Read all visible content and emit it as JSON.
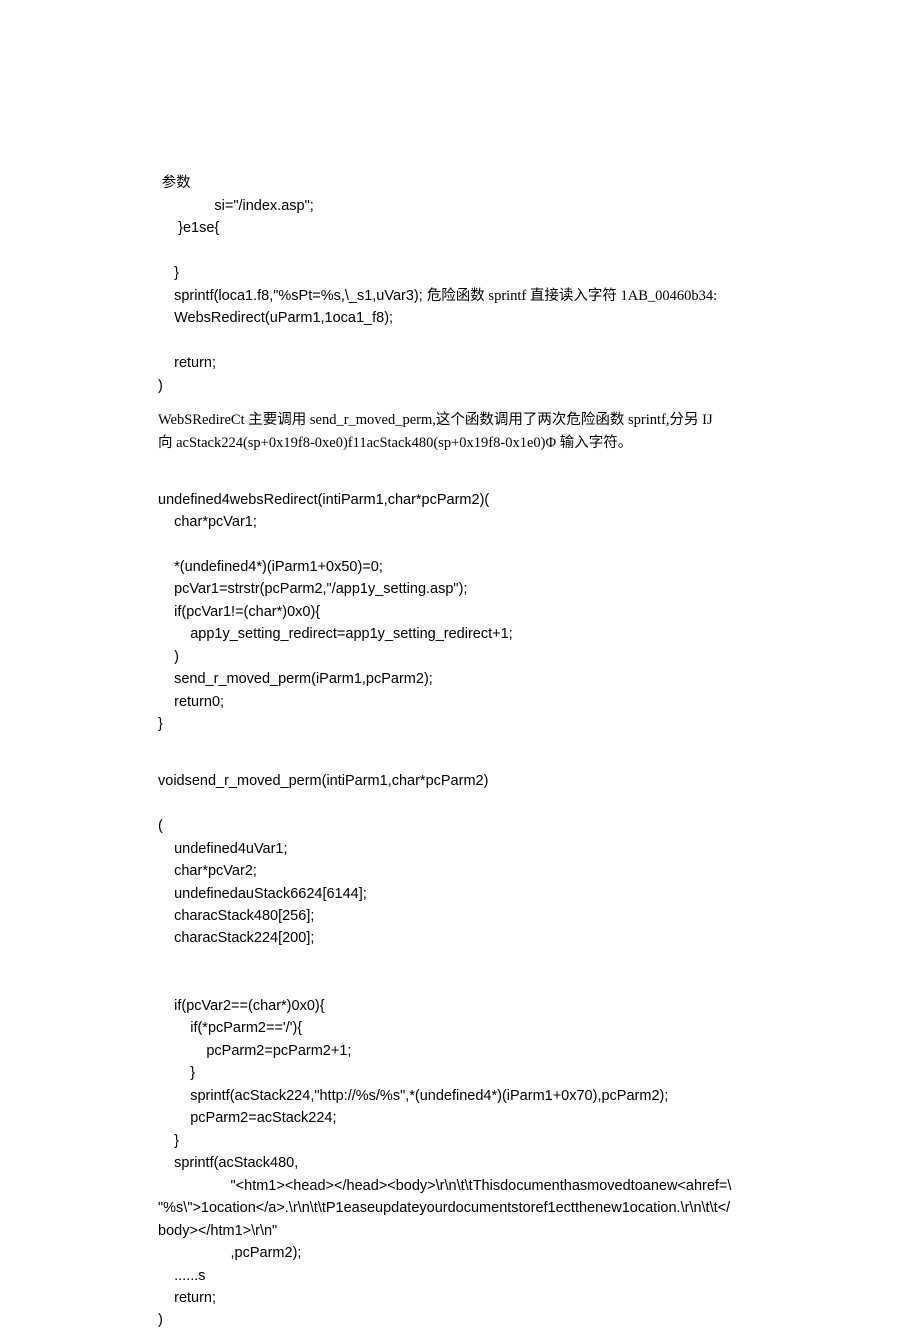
{
  "block1": {
    "l1": " 参数",
    "l2": "              si=\"/index.asp\";",
    "l3": "     }e1se{",
    "l4": "",
    "l5": "    }",
    "l6a": "    sprintf(loca1.f8,\"%sPt=%s,\\_s1,uVar3); ",
    "l6b": "危险函数 sprintf 直接读入字符 1AB_00460b34:",
    "l7": "    WebsRedirect(uParm1,1oca1_f8);",
    "l8": "",
    "l9": "    return;",
    "l10": ")"
  },
  "para1": {
    "a": "WebSRedireCt 主要调用 send_r_moved_perm,这个函数调用了两次危险函数 sprintf,分另 IJ",
    "b": "向 acStack224(sp+0x19f8-0xe0)f11acStack480(sp+0x19f8-0x1e0)Φ 输入字符。"
  },
  "block2": {
    "l1": "undefined4websRedirect(intiParm1,char*pcParm2)(",
    "l2": "    char*pcVar1;",
    "l3": "",
    "l4": "    *(undefined4*)(iParm1+0x50)=0;",
    "l5": "    pcVar1=strstr(pcParm2,\"/app1y_setting.asp\");",
    "l6": "    if(pcVar1!=(char*)0x0){",
    "l7": "        app1y_setting_redirect=app1y_setting_redirect+1;",
    "l8": "    )",
    "l9": "    send_r_moved_perm(iParm1,pcParm2);",
    "l10": "    return0;",
    "l11": "}"
  },
  "block3": {
    "l1": "voidsend_r_moved_perm(intiParm1,char*pcParm2)",
    "l2": "",
    "l3": "(",
    "l4": "    undefined4uVar1;",
    "l5": "    char*pcVar2;",
    "l6": "    undefinedauStack6624[6144];",
    "l7": "    characStack480[256];",
    "l8": "    characStack224[200];",
    "l9": "",
    "l10": "",
    "l11": "    if(pcVar2==(char*)0x0){",
    "l12": "        if(*pcParm2=='/'){",
    "l13": "            pcParm2=pcParm2+1;",
    "l14": "        }",
    "l15": "        sprintf(acStack224,\"http://%s/%s\",*(undefined4*)(iParm1+0x70),pcParm2);",
    "l16": "        pcParm2=acStack224;",
    "l17": "    }",
    "l18": "    sprintf(acStack480,",
    "l19": "                  \"<htm1><head></head><body>\\r\\n\\t\\tThisdocumenthasmovedtoanew<ahref=\\",
    "l20": "\"%s\\\">1ocation</a>.\\r\\n\\t\\tP1easeupdateyourdocumentstoref1ectthenew1ocation.\\r\\n\\t\\t</",
    "l21": "body></htm1>\\r\\n\"",
    "l22": "                  ,pcParm2);",
    "l23": "    ......s",
    "l24": "    return;",
    "l25": ")"
  }
}
